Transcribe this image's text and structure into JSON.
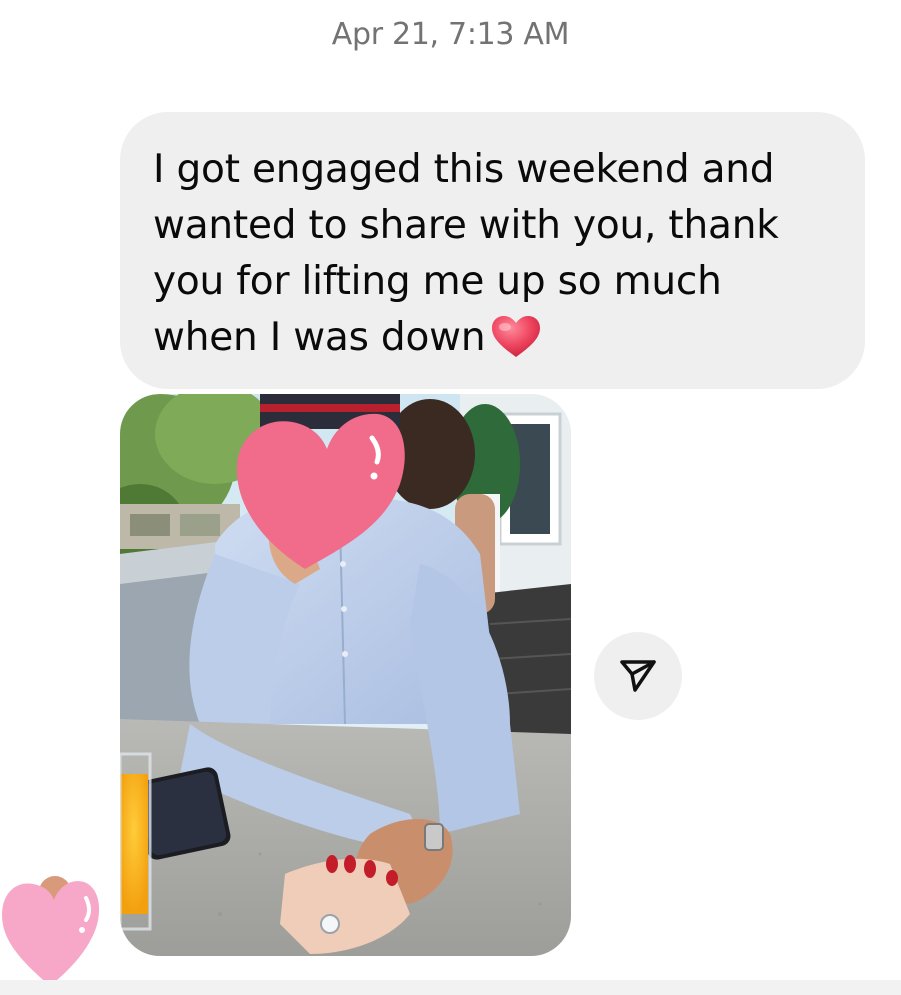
{
  "conversation": {
    "timestamp": "Apr 21, 7:13 AM",
    "message": {
      "text": "I got engaged this weekend and wanted to share with you, thank you for lifting me up so much when I was down",
      "emoji": "red-heart"
    },
    "photo": {
      "subject": "man in light blue shirt with face covered by pink heart sticker, woman's hand with engagement ring on cafe table"
    },
    "share_button_icon": "paper-plane-icon",
    "reaction_icon": "pink-heart-icon"
  },
  "colors": {
    "bubble": "#efefef",
    "text": "#0a0a0a",
    "timestamp": "#737373",
    "heart_red": "#e8364e",
    "sticker_pink": "#f06c8a",
    "reaction_pink": "#f7a8c8"
  }
}
